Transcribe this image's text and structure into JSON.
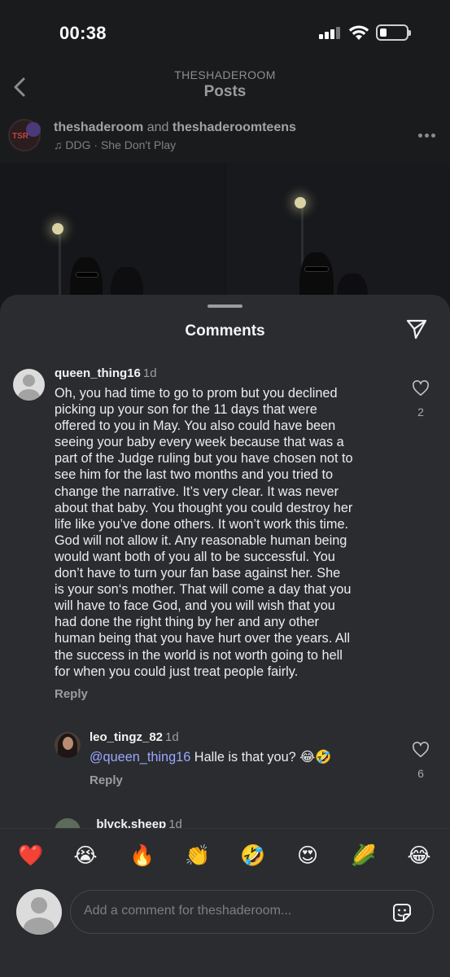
{
  "status_bar": {
    "time": "00:38"
  },
  "nav": {
    "subtitle": "THESHADEROOM",
    "title": "Posts"
  },
  "post": {
    "user1": "theshaderoom",
    "joiner": "and",
    "user2": "theshaderoomteens",
    "song": "DDG · She Don't Play",
    "avatar_text": "TSR"
  },
  "sheet": {
    "title": "Comments"
  },
  "comments": [
    {
      "username": "queen_thing16",
      "time": "1d",
      "lines": [
        "Oh, you had time to go to prom but you declined",
        "picking up your son for the 11 days that were",
        "offered to you in May. You also could have been",
        "seeing your baby every week because that was a",
        "part of the Judge ruling but you have chosen not to",
        "see him for the last two months and you tried to",
        "change the narrative. It’s very clear. It was never",
        "about that baby. You thought you could destroy her",
        "life like you’ve done others. It won’t work this time.",
        "God will not allow it. Any reasonable human being",
        "would want both of you all to be successful. You",
        "don’t have to turn  your fan base against her. She",
        "is your son‘s mother. That will come a day that you",
        "will have to face God, and you will wish that you",
        "had done the right thing by her and any other",
        "human being that you have hurt over the years. All",
        "the success in the world is not worth going to hell",
        "for when you could just treat people fairly."
      ],
      "reply_label": "Reply",
      "likes": "2"
    },
    {
      "username": "leo_tingz_82",
      "time": "1d",
      "mention": "@queen_thing16",
      "text": " Halle is that you? 😂🤣",
      "reply_label": "Reply",
      "likes": "6"
    },
    {
      "username": "_blvck.sheep",
      "time": "1d"
    }
  ],
  "emoji_bar": [
    "❤️",
    "😭",
    "🔥",
    "👏",
    "🤣",
    "😍",
    "🌽",
    "😂"
  ],
  "composer": {
    "placeholder": "Add a comment for theshaderoom..."
  },
  "colors": {
    "sheet_bg": "#2a2c30",
    "mention": "#9aa8ff",
    "text": "#ececec"
  }
}
